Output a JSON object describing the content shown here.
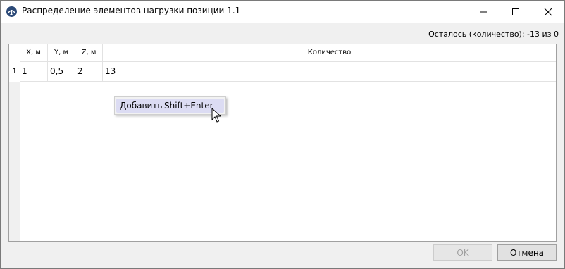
{
  "window": {
    "title": "Распределение элементов нагрузки позиции 1.1"
  },
  "remaining_label": "Осталось (количество): -13 из 0",
  "table": {
    "columns": [
      "X, м",
      "Y, м",
      "Z, м",
      "Количество"
    ],
    "rows": [
      {
        "num": "1",
        "cells": [
          "1",
          "0,5",
          "2",
          "13"
        ]
      }
    ]
  },
  "context_menu": {
    "item_label": "Добавить",
    "item_shortcut": "Shift+Enter"
  },
  "buttons": {
    "ok": "OK",
    "cancel": "Отмена"
  },
  "colors": {
    "menu_highlight": "#dcdcf3",
    "app_icon": "#2c4a78"
  }
}
